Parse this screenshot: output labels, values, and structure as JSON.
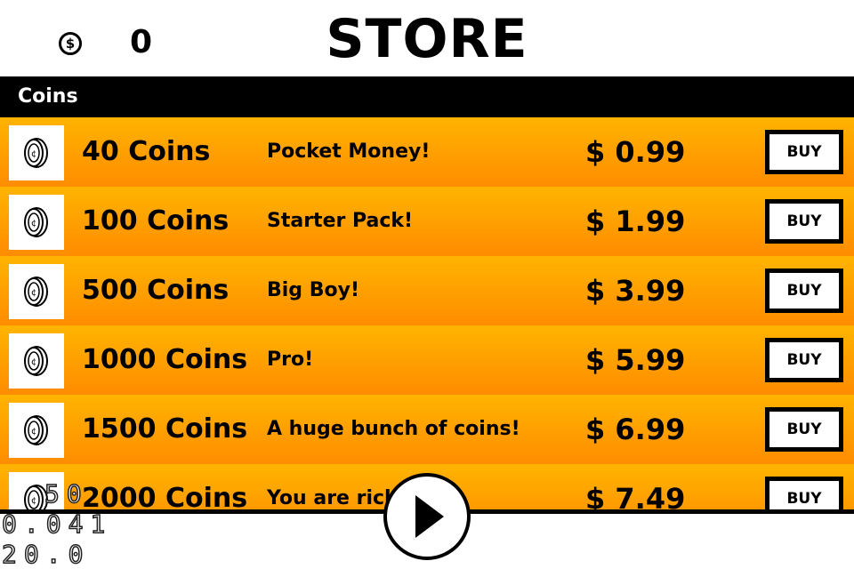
{
  "header": {
    "currency_symbol": "$",
    "balance": "0",
    "title": "STORE"
  },
  "section": {
    "label": "Coins"
  },
  "items": [
    {
      "name": "40 Coins",
      "desc": "Pocket Money!",
      "price": "$ 0.99",
      "buy": "BUY",
      "icon": "coin-icon"
    },
    {
      "name": "100 Coins",
      "desc": "Starter Pack!",
      "price": "$ 1.99",
      "buy": "BUY",
      "icon": "coin-icon"
    },
    {
      "name": "500 Coins",
      "desc": "Big Boy!",
      "price": "$ 3.99",
      "buy": "BUY",
      "icon": "coin-icon"
    },
    {
      "name": "1000 Coins",
      "desc": "Pro!",
      "price": "$ 5.99",
      "buy": "BUY",
      "icon": "coin-icon"
    },
    {
      "name": "1500 Coins",
      "desc": "A huge bunch of coins!",
      "price": "$ 6.99",
      "buy": "BUY",
      "icon": "coin-icon"
    },
    {
      "name": "2000 Coins",
      "desc": "You are rich!",
      "price": "$ 7.49",
      "buy": "BUY",
      "icon": "coin-icon"
    }
  ],
  "play": {
    "icon": "play-icon"
  },
  "debug": {
    "fps": "50",
    "frame_time": "0.041",
    "rate": "20.0"
  },
  "colors": {
    "row_top": "#ffb400",
    "row_bottom": "#ff8c00",
    "bar": "#000000"
  }
}
